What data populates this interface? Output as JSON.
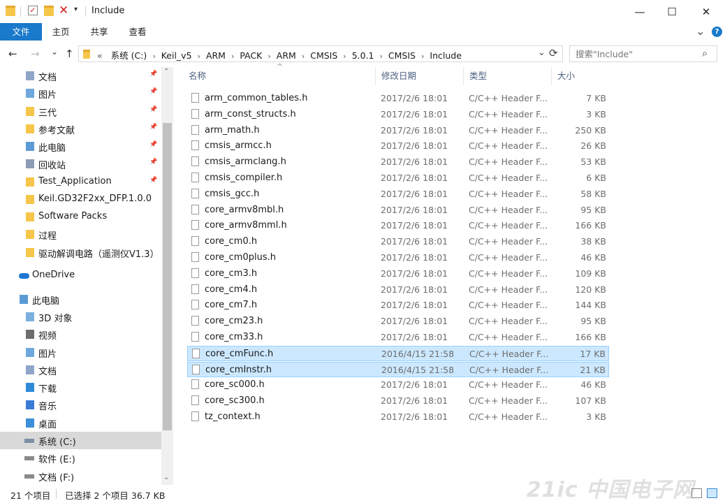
{
  "window": {
    "title": "Include",
    "minimize": "—",
    "maximize": "☐",
    "close": "✕"
  },
  "ribbon": {
    "tabs": [
      {
        "label": "文件"
      },
      {
        "label": "主页"
      },
      {
        "label": "共享"
      },
      {
        "label": "查看"
      }
    ],
    "expand": "⌄",
    "help": "?"
  },
  "address": {
    "back": "←",
    "forward": "→",
    "recent": "⌄",
    "up": "↑",
    "overflow": "«",
    "crumbs": [
      "系统 (C:)",
      "Keil_v5",
      "ARM",
      "PACK",
      "ARM",
      "CMSIS",
      "5.0.1",
      "CMSIS",
      "Include"
    ],
    "separator": "›",
    "dropdown": "⌄",
    "refresh": "⟳"
  },
  "search": {
    "placeholder": "搜索\"Include\"",
    "icon": "⌕"
  },
  "nav": {
    "pin": "📌",
    "items": [
      {
        "label": "文档",
        "icon": "documents-icon",
        "pinned": true
      },
      {
        "label": "图片",
        "icon": "pictures-icon",
        "pinned": true
      },
      {
        "label": "三代",
        "icon": "folder-icon",
        "pinned": true
      },
      {
        "label": "参考文献",
        "icon": "folder-icon",
        "pinned": true
      },
      {
        "label": "此电脑",
        "icon": "computer-icon",
        "pinned": true
      },
      {
        "label": "回收站",
        "icon": "recycle-bin-icon",
        "pinned": true
      },
      {
        "label": "Test_Application",
        "icon": "folder-icon",
        "pinned": true
      },
      {
        "label": "Keil.GD32F2xx_DFP.1.0.0",
        "icon": "folder-icon",
        "pinned": false
      },
      {
        "label": "Software Packs",
        "icon": "folder-icon",
        "pinned": false
      },
      {
        "label": "过程",
        "icon": "folder-icon",
        "pinned": false
      },
      {
        "label": "驱动解调电路（遥测仪V1.3）",
        "icon": "folder-icon",
        "pinned": false
      },
      {
        "label": "OneDrive",
        "icon": "onedrive-icon",
        "pinned": false
      },
      {
        "label": "此电脑",
        "icon": "computer-icon",
        "pinned": false
      },
      {
        "label": "3D 对象",
        "icon": "3d-objects-icon",
        "pinned": false
      },
      {
        "label": "视频",
        "icon": "videos-icon",
        "pinned": false
      },
      {
        "label": "图片",
        "icon": "pictures-icon",
        "pinned": false
      },
      {
        "label": "文档",
        "icon": "documents-icon",
        "pinned": false
      },
      {
        "label": "下载",
        "icon": "downloads-icon",
        "pinned": false
      },
      {
        "label": "音乐",
        "icon": "music-icon",
        "pinned": false
      },
      {
        "label": "桌面",
        "icon": "desktop-icon",
        "pinned": false
      },
      {
        "label": "系统 (C:)",
        "icon": "drive-c-icon",
        "pinned": false
      },
      {
        "label": "软件 (E:)",
        "icon": "drive-icon",
        "pinned": false
      },
      {
        "label": "文档 (F:)",
        "icon": "drive-icon",
        "pinned": false
      }
    ],
    "scroll_up": "⌃",
    "scroll_down": "⌄"
  },
  "columns": {
    "sort_indicator": "^",
    "name": "名称",
    "date": "修改日期",
    "type": "类型",
    "size": "大小"
  },
  "files": [
    {
      "name": "arm_common_tables.h",
      "date": "2017/2/6 18:01",
      "type": "C/C++ Header F...",
      "size": "7 KB",
      "selected": false
    },
    {
      "name": "arm_const_structs.h",
      "date": "2017/2/6 18:01",
      "type": "C/C++ Header F...",
      "size": "3 KB",
      "selected": false
    },
    {
      "name": "arm_math.h",
      "date": "2017/2/6 18:01",
      "type": "C/C++ Header F...",
      "size": "250 KB",
      "selected": false
    },
    {
      "name": "cmsis_armcc.h",
      "date": "2017/2/6 18:01",
      "type": "C/C++ Header F...",
      "size": "26 KB",
      "selected": false
    },
    {
      "name": "cmsis_armclang.h",
      "date": "2017/2/6 18:01",
      "type": "C/C++ Header F...",
      "size": "53 KB",
      "selected": false
    },
    {
      "name": "cmsis_compiler.h",
      "date": "2017/2/6 18:01",
      "type": "C/C++ Header F...",
      "size": "6 KB",
      "selected": false
    },
    {
      "name": "cmsis_gcc.h",
      "date": "2017/2/6 18:01",
      "type": "C/C++ Header F...",
      "size": "58 KB",
      "selected": false
    },
    {
      "name": "core_armv8mbl.h",
      "date": "2017/2/6 18:01",
      "type": "C/C++ Header F...",
      "size": "95 KB",
      "selected": false
    },
    {
      "name": "core_armv8mml.h",
      "date": "2017/2/6 18:01",
      "type": "C/C++ Header F...",
      "size": "166 KB",
      "selected": false
    },
    {
      "name": "core_cm0.h",
      "date": "2017/2/6 18:01",
      "type": "C/C++ Header F...",
      "size": "38 KB",
      "selected": false
    },
    {
      "name": "core_cm0plus.h",
      "date": "2017/2/6 18:01",
      "type": "C/C++ Header F...",
      "size": "46 KB",
      "selected": false
    },
    {
      "name": "core_cm3.h",
      "date": "2017/2/6 18:01",
      "type": "C/C++ Header F...",
      "size": "109 KB",
      "selected": false
    },
    {
      "name": "core_cm4.h",
      "date": "2017/2/6 18:01",
      "type": "C/C++ Header F...",
      "size": "120 KB",
      "selected": false
    },
    {
      "name": "core_cm7.h",
      "date": "2017/2/6 18:01",
      "type": "C/C++ Header F...",
      "size": "144 KB",
      "selected": false
    },
    {
      "name": "core_cm23.h",
      "date": "2017/2/6 18:01",
      "type": "C/C++ Header F...",
      "size": "95 KB",
      "selected": false
    },
    {
      "name": "core_cm33.h",
      "date": "2017/2/6 18:01",
      "type": "C/C++ Header F...",
      "size": "166 KB",
      "selected": false
    },
    {
      "name": "core_cmFunc.h",
      "date": "2016/4/15 21:58",
      "type": "C/C++ Header F...",
      "size": "17 KB",
      "selected": true
    },
    {
      "name": "core_cmInstr.h",
      "date": "2016/4/15 21:58",
      "type": "C/C++ Header F...",
      "size": "21 KB",
      "selected": true
    },
    {
      "name": "core_sc000.h",
      "date": "2017/2/6 18:01",
      "type": "C/C++ Header F...",
      "size": "46 KB",
      "selected": false
    },
    {
      "name": "core_sc300.h",
      "date": "2017/2/6 18:01",
      "type": "C/C++ Header F...",
      "size": "107 KB",
      "selected": false
    },
    {
      "name": "tz_context.h",
      "date": "2017/2/6 18:01",
      "type": "C/C++ Header F...",
      "size": "3 KB",
      "selected": false
    }
  ],
  "status": {
    "count": "21 个项目",
    "selection": "已选择 2 个项目 36.7 KB",
    "watermark": "21ic 中国电子网"
  },
  "colors": {
    "accent": "#1979ca",
    "selection_bg": "#cce8ff",
    "selection_border": "#99d1ff",
    "folder": "#f6c64a"
  }
}
